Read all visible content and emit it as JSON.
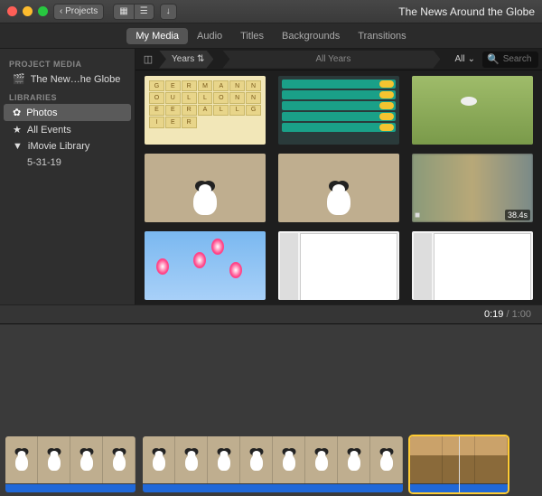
{
  "titlebar": {
    "back_label": "Projects",
    "title": "The News Around the Globe"
  },
  "tabs": [
    {
      "label": "My Media",
      "active": true
    },
    {
      "label": "Audio",
      "active": false
    },
    {
      "label": "Titles",
      "active": false
    },
    {
      "label": "Backgrounds",
      "active": false
    },
    {
      "label": "Transitions",
      "active": false
    }
  ],
  "sidebar": {
    "section_project": "PROJECT MEDIA",
    "project_item": "The New…he Globe",
    "section_libraries": "LIBRARIES",
    "items": [
      {
        "label": "Photos",
        "icon": "flower-icon",
        "selected": true
      },
      {
        "label": "All Events",
        "icon": "star-icon",
        "selected": false
      },
      {
        "label": "iMovie Library",
        "icon": "disclosure-icon",
        "selected": false
      },
      {
        "label": "5-31-19",
        "icon": "",
        "selected": false,
        "sub": true
      }
    ]
  },
  "filter": {
    "group_label": "Years",
    "scope_label": "All Years",
    "all_label": "All",
    "search_placeholder": "Search"
  },
  "media": [
    {
      "kind": "word-game"
    },
    {
      "kind": "quiz-game"
    },
    {
      "kind": "grass-dog"
    },
    {
      "kind": "dog-floor"
    },
    {
      "kind": "dog-floor"
    },
    {
      "kind": "blur-video",
      "duration": "38.4s",
      "is_video": true
    },
    {
      "kind": "sky-eggs"
    },
    {
      "kind": "settings-ui"
    },
    {
      "kind": "settings-ui"
    }
  ],
  "playback": {
    "current": "0:19",
    "total": "1:00"
  },
  "timeline": {
    "clips": [
      {
        "frames": 4,
        "style": "dog",
        "selected": false
      },
      {
        "frames": 8,
        "style": "dog",
        "selected": false
      },
      {
        "frames": 3,
        "style": "table",
        "selected": true
      }
    ]
  }
}
